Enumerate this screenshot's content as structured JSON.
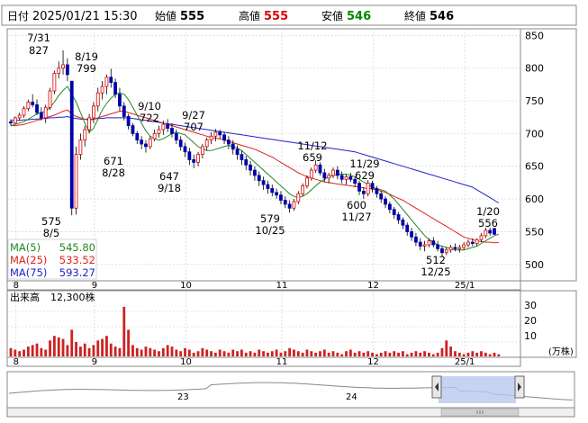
{
  "header": {
    "date_label": "日付",
    "datetime": "2025/01/21 15:30",
    "open_label": "始値",
    "open_value": "555",
    "high_label": "高値",
    "high_value": "555",
    "low_label": "安値",
    "low_value": "546",
    "close_label": "終値",
    "close_value": "546",
    "colors": {
      "high": "#dd0000",
      "low": "#008800",
      "close": "#000000",
      "open": "#000000"
    }
  },
  "legend": {
    "ma5_label": "MA(5)",
    "ma5_value": "545.80",
    "ma25_label": "MA(25)",
    "ma25_value": "533.52",
    "ma75_label": "MA(75)",
    "ma75_value": "593.27"
  },
  "volume_panel": {
    "title": "出来高",
    "current": "12,300株",
    "unit": "(万株)",
    "y_ticks": [
      "30",
      "20",
      "10"
    ]
  },
  "navigator": {
    "labels": [
      "23",
      "24"
    ]
  },
  "chart_data": {
    "type": "candlestick",
    "price_ticks": [
      850,
      800,
      750,
      700,
      650,
      600,
      550,
      500
    ],
    "ylim": [
      475,
      860
    ],
    "x_month_labels": [
      "8",
      "9",
      "10",
      "11",
      "12",
      "25/1"
    ],
    "annotations": [
      {
        "top": "7/31",
        "bottom": "827"
      },
      {
        "top": "8/19",
        "bottom": "799"
      },
      {
        "top": "9/10",
        "bottom": "722"
      },
      {
        "top": "9/27",
        "bottom": "707"
      },
      {
        "top": "671",
        "bottom": "8/28"
      },
      {
        "top": "647",
        "bottom": "9/18"
      },
      {
        "top": "575",
        "bottom": "8/5"
      },
      {
        "top": "11/12",
        "bottom": "659"
      },
      {
        "top": "11/29",
        "bottom": "629"
      },
      {
        "top": "579",
        "bottom": "10/25"
      },
      {
        "top": "600",
        "bottom": "11/27"
      },
      {
        "top": "512",
        "bottom": "12/25"
      },
      {
        "top": "1/20",
        "bottom": "556"
      }
    ],
    "colors": {
      "up": "#dd0000",
      "down": "#0000aa",
      "ma5": "#228822",
      "ma25": "#dd2222",
      "ma75": "#2222cc",
      "volume": "#cc2222"
    },
    "volume_ylim": [
      0,
      40
    ],
    "candles": [
      [
        718,
        722,
        712,
        716
      ],
      [
        716,
        726,
        714,
        724
      ],
      [
        724,
        732,
        720,
        728
      ],
      [
        728,
        742,
        724,
        738
      ],
      [
        738,
        752,
        734,
        748
      ],
      [
        748,
        760,
        740,
        744
      ],
      [
        744,
        752,
        728,
        732
      ],
      [
        732,
        740,
        720,
        724
      ],
      [
        724,
        744,
        716,
        740
      ],
      [
        740,
        770,
        736,
        765
      ],
      [
        765,
        796,
        760,
        792
      ],
      [
        792,
        810,
        784,
        800
      ],
      [
        800,
        827,
        790,
        805
      ],
      [
        805,
        815,
        780,
        790
      ],
      [
        780,
        780,
        575,
        586
      ],
      [
        586,
        680,
        576,
        668
      ],
      [
        668,
        700,
        660,
        690
      ],
      [
        690,
        712,
        680,
        706
      ],
      [
        706,
        730,
        700,
        724
      ],
      [
        724,
        748,
        716,
        742
      ],
      [
        742,
        770,
        734,
        762
      ],
      [
        762,
        780,
        752,
        772
      ],
      [
        772,
        790,
        760,
        786
      ],
      [
        786,
        799,
        770,
        778
      ],
      [
        778,
        784,
        754,
        760
      ],
      [
        760,
        770,
        734,
        742
      ],
      [
        742,
        748,
        720,
        726
      ],
      [
        726,
        730,
        706,
        712
      ],
      [
        712,
        716,
        696,
        700
      ],
      [
        700,
        704,
        684,
        690
      ],
      [
        690,
        696,
        676,
        684
      ],
      [
        684,
        690,
        671,
        680
      ],
      [
        680,
        696,
        676,
        692
      ],
      [
        692,
        706,
        688,
        700
      ],
      [
        700,
        712,
        694,
        706
      ],
      [
        706,
        720,
        698,
        714
      ],
      [
        714,
        722,
        702,
        708
      ],
      [
        708,
        716,
        694,
        700
      ],
      [
        700,
        706,
        684,
        690
      ],
      [
        690,
        696,
        674,
        680
      ],
      [
        680,
        686,
        664,
        672
      ],
      [
        672,
        678,
        652,
        660
      ],
      [
        660,
        668,
        647,
        656
      ],
      [
        656,
        672,
        650,
        668
      ],
      [
        668,
        684,
        662,
        680
      ],
      [
        680,
        694,
        674,
        690
      ],
      [
        690,
        702,
        684,
        696
      ],
      [
        696,
        707,
        688,
        702
      ],
      [
        702,
        706,
        692,
        698
      ],
      [
        698,
        702,
        684,
        690
      ],
      [
        690,
        696,
        676,
        684
      ],
      [
        684,
        690,
        668,
        676
      ],
      [
        676,
        682,
        660,
        668
      ],
      [
        668,
        674,
        652,
        660
      ],
      [
        660,
        666,
        644,
        652
      ],
      [
        652,
        658,
        636,
        644
      ],
      [
        644,
        650,
        628,
        636
      ],
      [
        636,
        642,
        620,
        628
      ],
      [
        628,
        634,
        614,
        622
      ],
      [
        622,
        628,
        608,
        616
      ],
      [
        616,
        622,
        604,
        610
      ],
      [
        610,
        616,
        600,
        606
      ],
      [
        606,
        612,
        592,
        598
      ],
      [
        598,
        604,
        586,
        592
      ],
      [
        592,
        598,
        579,
        586
      ],
      [
        586,
        600,
        582,
        596
      ],
      [
        596,
        612,
        592,
        608
      ],
      [
        608,
        624,
        604,
        620
      ],
      [
        620,
        636,
        616,
        632
      ],
      [
        632,
        648,
        628,
        644
      ],
      [
        644,
        659,
        640,
        652
      ],
      [
        652,
        656,
        636,
        640
      ],
      [
        640,
        646,
        626,
        632
      ],
      [
        632,
        640,
        624,
        636
      ],
      [
        636,
        648,
        632,
        644
      ],
      [
        644,
        650,
        630,
        636
      ],
      [
        636,
        642,
        624,
        630
      ],
      [
        630,
        638,
        622,
        634
      ],
      [
        634,
        640,
        626,
        630
      ],
      [
        630,
        634,
        618,
        624
      ],
      [
        624,
        628,
        606,
        612
      ],
      [
        612,
        618,
        600,
        608
      ],
      [
        608,
        629,
        604,
        624
      ],
      [
        624,
        628,
        610,
        616
      ],
      [
        616,
        620,
        602,
        608
      ],
      [
        608,
        612,
        594,
        600
      ],
      [
        600,
        604,
        586,
        592
      ],
      [
        592,
        596,
        578,
        584
      ],
      [
        584,
        588,
        570,
        576
      ],
      [
        576,
        580,
        562,
        568
      ],
      [
        568,
        572,
        554,
        560
      ],
      [
        560,
        564,
        544,
        550
      ],
      [
        550,
        556,
        536,
        542
      ],
      [
        542,
        548,
        528,
        534
      ],
      [
        534,
        540,
        522,
        528
      ],
      [
        528,
        536,
        520,
        530
      ],
      [
        530,
        540,
        526,
        536
      ],
      [
        536,
        542,
        526,
        530
      ],
      [
        530,
        536,
        520,
        524
      ],
      [
        524,
        528,
        512,
        518
      ],
      [
        518,
        526,
        514,
        522
      ],
      [
        522,
        530,
        518,
        526
      ],
      [
        526,
        532,
        520,
        524
      ],
      [
        524,
        530,
        518,
        526
      ],
      [
        526,
        534,
        522,
        530
      ],
      [
        530,
        538,
        526,
        534
      ],
      [
        534,
        540,
        528,
        532
      ],
      [
        532,
        540,
        528,
        538
      ],
      [
        538,
        548,
        534,
        544
      ],
      [
        544,
        556,
        540,
        552
      ],
      [
        552,
        556,
        544,
        548
      ],
      [
        555,
        555,
        546,
        546
      ]
    ],
    "ma5": [
      712,
      714,
      716,
      718,
      722,
      726,
      730,
      732,
      734,
      740,
      748,
      758,
      766,
      772,
      760,
      748,
      732,
      716,
      702,
      708,
      722,
      736,
      746,
      754,
      760,
      762,
      760,
      752,
      740,
      728,
      716,
      704,
      696,
      692,
      690,
      692,
      696,
      700,
      702,
      700,
      698,
      692,
      686,
      680,
      676,
      674,
      674,
      676,
      678,
      680,
      682,
      680,
      678,
      674,
      668,
      662,
      656,
      650,
      644,
      638,
      632,
      626,
      620,
      614,
      608,
      604,
      602,
      604,
      608,
      614,
      620,
      626,
      630,
      634,
      636,
      638,
      638,
      638,
      636,
      634,
      630,
      626,
      622,
      618,
      616,
      614,
      612,
      606,
      600,
      592,
      584,
      576,
      568,
      560,
      552,
      544,
      538,
      534,
      530,
      528,
      526,
      524,
      522,
      522,
      522,
      524,
      526,
      528,
      532,
      536,
      540,
      544,
      546
    ],
    "ma25": [
      712,
      712,
      713,
      714,
      716,
      718,
      720,
      722,
      724,
      726,
      728,
      731,
      734,
      736,
      730,
      726,
      724,
      722,
      720,
      722,
      724,
      726,
      728,
      730,
      732,
      734,
      734,
      732,
      730,
      728,
      726,
      724,
      722,
      720,
      718,
      716,
      714,
      712,
      710,
      708,
      706,
      704,
      702,
      700,
      698,
      696,
      694,
      693,
      692,
      690,
      688,
      686,
      684,
      682,
      680,
      678,
      676,
      673,
      670,
      667,
      664,
      660,
      656,
      652,
      648,
      644,
      640,
      637,
      634,
      632,
      630,
      628,
      626,
      625,
      624,
      623,
      622,
      621,
      620,
      619,
      618,
      617,
      616,
      615,
      614,
      612,
      610,
      607,
      604,
      601,
      598,
      594,
      590,
      586,
      582,
      578,
      574,
      570,
      566,
      562,
      558,
      554,
      550,
      546,
      542,
      540,
      538,
      536,
      535,
      534,
      534,
      533,
      533.5
    ],
    "ma75": [
      720,
      720,
      720,
      721,
      721,
      722,
      722,
      723,
      723,
      724,
      724,
      725,
      725,
      726,
      724,
      723,
      722,
      722,
      722,
      722,
      723,
      723,
      724,
      724,
      724,
      724,
      724,
      724,
      723,
      722,
      721,
      720,
      719,
      718,
      717,
      716,
      715,
      714,
      713,
      712,
      711,
      710,
      709,
      708,
      707,
      706,
      705,
      704,
      703,
      702,
      701,
      700,
      699,
      698,
      697,
      696,
      695,
      694,
      693,
      692,
      691,
      690,
      689,
      688,
      687,
      686,
      685,
      684,
      683,
      682,
      681,
      680,
      679,
      678,
      677,
      676,
      675,
      674,
      673,
      672,
      670,
      668,
      666,
      664,
      662,
      660,
      658,
      656,
      654,
      652,
      650,
      648,
      646,
      644,
      642,
      640,
      638,
      636,
      634,
      632,
      630,
      628,
      626,
      624,
      622,
      620,
      618,
      614,
      610,
      606,
      602,
      598,
      594
    ],
    "volume": [
      6,
      5,
      4,
      5,
      7,
      8,
      9,
      6,
      5,
      11,
      14,
      13,
      12,
      8,
      18,
      10,
      7,
      9,
      6,
      8,
      11,
      12,
      14,
      9,
      7,
      6,
      33,
      18,
      8,
      6,
      5,
      7,
      6,
      5,
      4,
      6,
      8,
      7,
      5,
      4,
      6,
      5,
      3,
      4,
      6,
      5,
      4,
      3,
      5,
      4,
      3,
      5,
      4,
      5,
      3,
      4,
      3,
      5,
      4,
      3,
      4,
      5,
      3,
      4,
      6,
      5,
      4,
      3,
      5,
      4,
      3,
      4,
      5,
      3,
      4,
      3,
      2,
      4,
      5,
      3,
      4,
      3,
      4,
      3,
      2,
      3,
      4,
      3,
      4,
      3,
      4,
      2,
      3,
      4,
      3,
      4,
      3,
      2,
      3,
      6,
      11,
      7,
      4,
      3,
      2,
      3,
      4,
      3,
      4,
      3,
      2,
      3,
      2
    ]
  }
}
